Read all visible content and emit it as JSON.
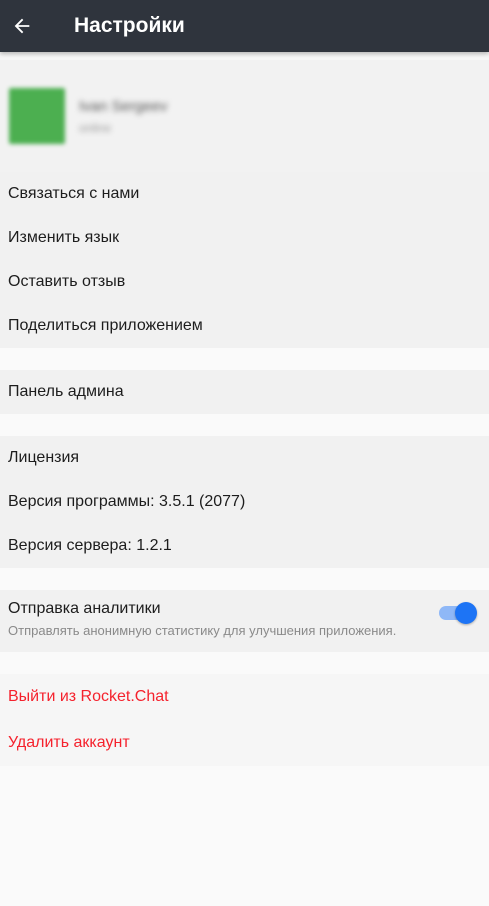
{
  "appbar": {
    "title": "Настройки",
    "back_icon": "arrow-left-icon"
  },
  "profile": {
    "name": "Ivan Sergeev",
    "status": "online",
    "avatar_color": "#4caf50"
  },
  "section1": [
    "Связаться с нами",
    "Изменить язык",
    "Оставить отзыв",
    "Поделиться приложением"
  ],
  "section2": [
    "Панель админа"
  ],
  "section3": [
    "Лицензия",
    "Версия программы: 3.5.1 (2077)",
    "Версия сервера: 1.2.1"
  ],
  "analytics": {
    "title": "Отправка аналитики",
    "description": "Отправлять анонимную статистику для улучшения приложения.",
    "enabled": true,
    "accent_color": "#1d74f5"
  },
  "danger": {
    "logout": "Выйти из Rocket.Chat",
    "delete": "Удалить аккаунт",
    "color": "#f5222d"
  }
}
